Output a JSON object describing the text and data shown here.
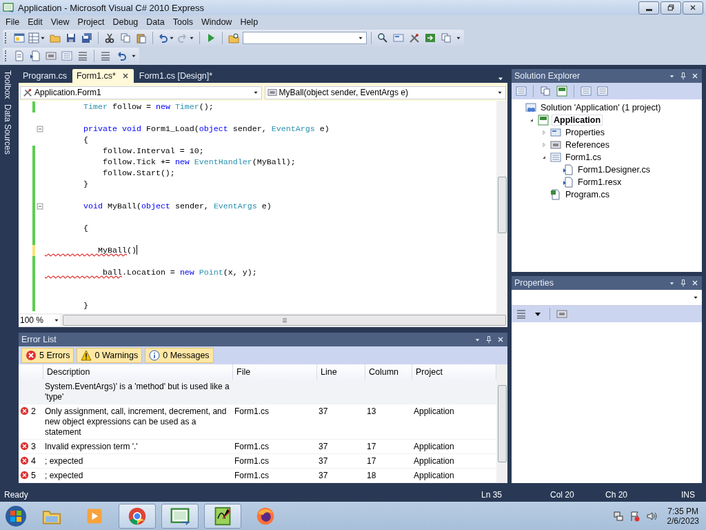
{
  "window": {
    "title": "Application - Microsoft Visual C# 2010 Express"
  },
  "menu": [
    "File",
    "Edit",
    "View",
    "Project",
    "Debug",
    "Data",
    "Tools",
    "Window",
    "Help"
  ],
  "side_strip": [
    "Toolbox",
    "Data Sources"
  ],
  "document_tabs": [
    {
      "label": "Program.cs",
      "selected": false
    },
    {
      "label": "Form1.cs*",
      "selected": true
    },
    {
      "label": "Form1.cs [Design]*",
      "selected": false
    }
  ],
  "navigation": {
    "type_combo": "Application.Form1",
    "member_combo": "MyBall(object sender, EventArgs e)"
  },
  "code_lines": [
    {
      "changed": true,
      "saved": true,
      "tokens": [
        {
          "text": "        Timer",
          "kind": "type"
        },
        {
          "text": " follow = ",
          "kind": "plain"
        },
        {
          "text": "new ",
          "kind": "keyword"
        },
        {
          "text": "Timer",
          "kind": "type"
        },
        {
          "text": "();",
          "kind": "plain"
        }
      ]
    },
    {
      "changed": false
    },
    {
      "changed": false,
      "collapsible": true,
      "tokens": [
        {
          "text": "        private void",
          "kind": "keyword"
        },
        {
          "text": " Form1_Load(",
          "kind": "plain"
        },
        {
          "text": "object",
          "kind": "keyword"
        },
        {
          "text": " sender, ",
          "kind": "plain"
        },
        {
          "text": "EventArgs",
          "kind": "type"
        },
        {
          "text": " e)",
          "kind": "plain"
        }
      ]
    },
    {
      "changed": false,
      "tokens": [
        {
          "text": "        {",
          "kind": "plain"
        }
      ]
    },
    {
      "changed": true,
      "saved": true,
      "tokens": [
        {
          "text": "            follow.Interval = 10;",
          "kind": "plain"
        }
      ]
    },
    {
      "changed": true,
      "saved": true,
      "tokens": [
        {
          "text": "            follow.Tick += ",
          "kind": "plain"
        },
        {
          "text": "new ",
          "kind": "keyword"
        },
        {
          "text": "EventHandler",
          "kind": "type"
        },
        {
          "text": "(MyBall);",
          "kind": "plain"
        }
      ]
    },
    {
      "changed": true,
      "saved": true,
      "tokens": [
        {
          "text": "            follow.Start();",
          "kind": "plain"
        }
      ]
    },
    {
      "changed": true,
      "saved": true,
      "tokens": [
        {
          "text": "        }",
          "kind": "plain"
        }
      ]
    },
    {
      "changed": true,
      "saved": true
    },
    {
      "changed": true,
      "saved": true,
      "collapsible": true,
      "tokens": [
        {
          "text": "        void",
          "kind": "keyword"
        },
        {
          "text": " MyBall(",
          "kind": "plain"
        },
        {
          "text": "object",
          "kind": "keyword"
        },
        {
          "text": " sender, ",
          "kind": "plain"
        },
        {
          "text": "EventArgs",
          "kind": "type"
        },
        {
          "text": " e)",
          "kind": "plain"
        }
      ]
    },
    {
      "changed": true,
      "saved": true
    },
    {
      "changed": true,
      "saved": true,
      "tokens": [
        {
          "text": "        {",
          "kind": "plain"
        }
      ]
    },
    {
      "changed": true,
      "saved": true
    },
    {
      "changed": true,
      "saved": false,
      "caret": true,
      "tokens": [
        {
          "text": "           MyBall",
          "kind": "error"
        },
        {
          "text": "()",
          "kind": "plain"
        }
      ]
    },
    {
      "changed": true,
      "saved": true
    },
    {
      "changed": true,
      "saved": true,
      "tokens": [
        {
          "text": "            ball",
          "kind": "error"
        },
        {
          "text": ".Location = ",
          "kind": "plain"
        },
        {
          "text": "new ",
          "kind": "keyword"
        },
        {
          "text": "Point",
          "kind": "type"
        },
        {
          "text": "(x, y);",
          "kind": "plain"
        }
      ]
    },
    {
      "changed": true,
      "saved": true
    },
    {
      "changed": true,
      "saved": true
    },
    {
      "changed": true,
      "saved": true,
      "tokens": [
        {
          "text": "        }",
          "kind": "plain"
        }
      ]
    }
  ],
  "zoom_combo": "100 %",
  "error_list": {
    "title": "Error List",
    "filters": [
      {
        "label": "5 Errors",
        "kind": "error",
        "selected": true
      },
      {
        "label": "0 Warnings",
        "kind": "warning",
        "selected": true
      },
      {
        "label": "0 Messages",
        "kind": "message",
        "selected": true
      }
    ],
    "columns": [
      "Description",
      "File",
      "Line",
      "Column",
      "Project"
    ],
    "rows": [
      {
        "kind": "continuation",
        "description": "System.EventArgs)' is a 'method' but is used like a 'type'"
      },
      {
        "kind": "error",
        "number": "2",
        "description": "Only assignment, call, increment, decrement, and new object expressions can be used as a statement",
        "file": "Form1.cs",
        "line": "37",
        "column": "13",
        "project": "Application"
      },
      {
        "kind": "error",
        "number": "3",
        "description": "Invalid expression term '.'",
        "file": "Form1.cs",
        "line": "37",
        "column": "17",
        "project": "Application"
      },
      {
        "kind": "error",
        "number": "4",
        "description": "; expected",
        "file": "Form1.cs",
        "line": "37",
        "column": "17",
        "project": "Application"
      },
      {
        "kind": "error",
        "number": "5",
        "description": "; expected",
        "file": "Form1.cs",
        "line": "37",
        "column": "18",
        "project": "Application"
      }
    ]
  },
  "solution_explorer": {
    "title": "Solution Explorer",
    "tree": [
      {
        "label": "Solution 'Application' (1 project)",
        "kind": "solution",
        "selected": false,
        "children": [
          {
            "label": "Application",
            "kind": "project",
            "selected": true,
            "expanded": true,
            "children": [
              {
                "label": "Properties",
                "kind": "properties",
                "selected": false,
                "expanded": false
              },
              {
                "label": "References",
                "kind": "references",
                "selected": false,
                "expanded": false
              },
              {
                "label": "Form1.cs",
                "kind": "form",
                "selected": false,
                "expanded": true,
                "children": [
                  {
                    "label": "Form1.Designer.cs",
                    "kind": "subfile",
                    "selected": false
                  },
                  {
                    "label": "Form1.resx",
                    "kind": "subfile",
                    "selected": false
                  }
                ]
              },
              {
                "label": "Program.cs",
                "kind": "csfile",
                "selected": false
              }
            ]
          }
        ]
      }
    ]
  },
  "properties": {
    "title": "Properties"
  },
  "status_bar": {
    "message": "Ready",
    "line": "Ln 35",
    "column": "Col 20",
    "char": "Ch 20",
    "mode": "INS"
  },
  "taskbar": {
    "apps": [
      {
        "kind": "explorer",
        "open": false
      },
      {
        "kind": "media",
        "open": false
      },
      {
        "kind": "chrome",
        "open": true
      },
      {
        "kind": "vs",
        "open": true
      },
      {
        "kind": "editor",
        "open": true
      },
      {
        "kind": "firefox",
        "open": false
      }
    ],
    "time": "7:35 PM",
    "date": "2/6/2023"
  }
}
